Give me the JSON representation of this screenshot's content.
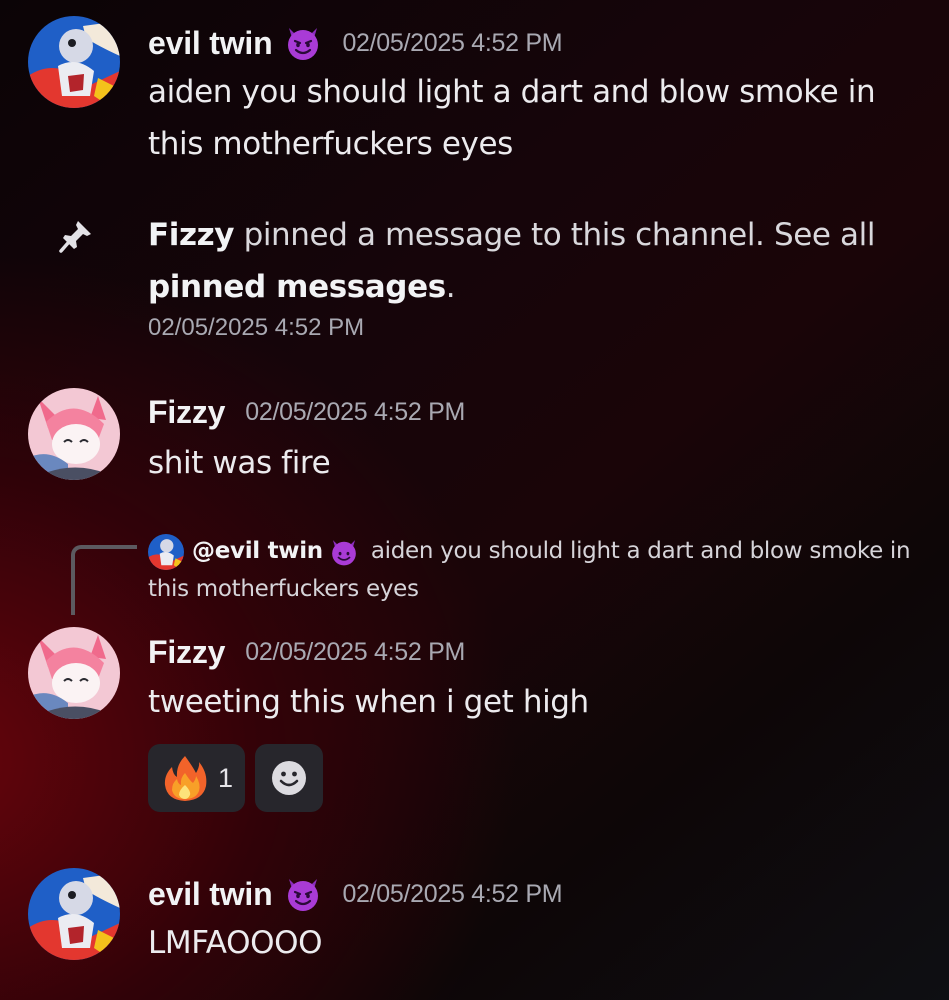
{
  "messages": [
    {
      "username": "evil twin",
      "timestamp": "02/05/2025 4:52 PM",
      "content": "aiden you should light a dart and blow smoke in this motherfuckers eyes"
    },
    {
      "username": "Fizzy",
      "timestamp": "02/05/2025 4:52 PM",
      "content": "shit was fire"
    },
    {
      "username": "Fizzy",
      "timestamp": "02/05/2025 4:52 PM",
      "content": "tweeting this when i get high"
    },
    {
      "username": "evil twin",
      "timestamp": "02/05/2025 4:52 PM",
      "content": "LMFAOOOO"
    }
  ],
  "system_message": {
    "actor": "Fizzy",
    "text_before": " pinned a message to this channel. See all ",
    "link_text": "pinned messages",
    "text_after": ".",
    "timestamp": "02/05/2025 4:52 PM"
  },
  "reply": {
    "mention": "@evil twin",
    "excerpt": "aiden you should light a dart and blow smoke in this motherfuckers eyes"
  },
  "reactions": [
    {
      "emoji": "fire-emoji",
      "count": "1"
    }
  ],
  "icons": {
    "devil_emoji": "smiling-face-with-horns",
    "pin": "pin-icon",
    "add_reaction": "add-reaction-icon"
  },
  "colors": {
    "username": "#f2f3f5",
    "timestamp": "#a9a9b2",
    "reaction_bg": "#27262c",
    "devil_emoji": "#a93bd6"
  }
}
